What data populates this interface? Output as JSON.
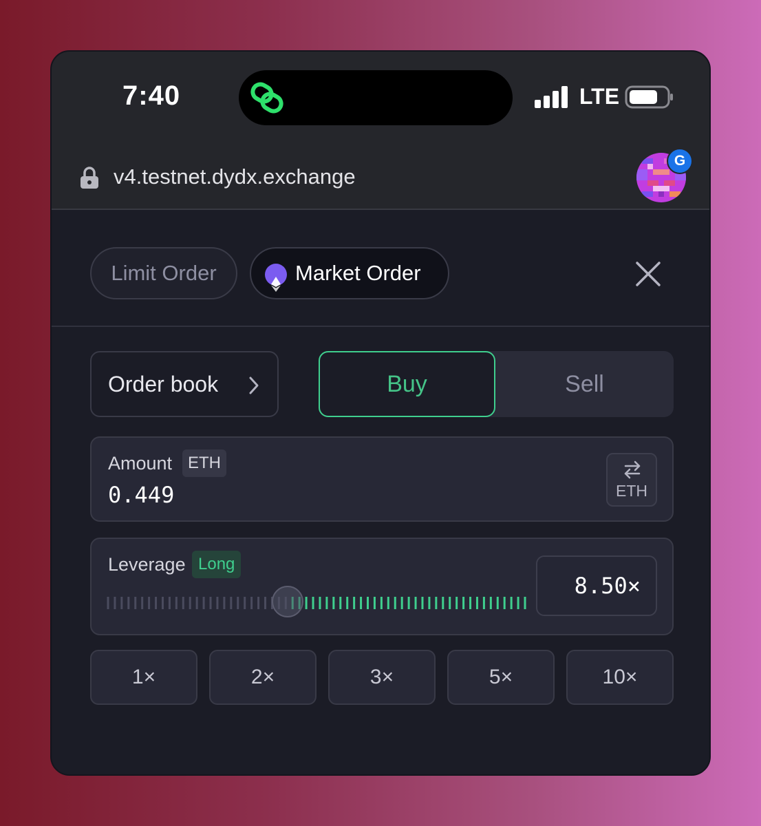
{
  "status_bar": {
    "time": "7:40",
    "network": "LTE"
  },
  "browser": {
    "url": "v4.testnet.dydx.exchange",
    "profile_badge": "G"
  },
  "order_tabs": {
    "limit_label": "Limit Order",
    "market_label": "Market Order",
    "active": "Market Order"
  },
  "trade": {
    "order_book_label": "Order book",
    "buy_label": "Buy",
    "sell_label": "Sell",
    "selected_side": "Buy"
  },
  "amount": {
    "label": "Amount",
    "asset": "ETH",
    "value": "0.449",
    "swap_label": "ETH"
  },
  "leverage": {
    "label": "Leverage",
    "direction": "Long",
    "value": "8.50×",
    "slider_fraction": 0.43
  },
  "presets": [
    "1×",
    "2×",
    "3×",
    "5×",
    "10×"
  ],
  "colors": {
    "accent_green": "#3fcf8e",
    "panel_bg": "#1b1c26",
    "eth_purple": "#7b5cf0"
  },
  "icons": [
    "dynamic-island-link-icon",
    "signal-icon",
    "battery-icon",
    "lock-icon",
    "ethereum-icon",
    "close-icon",
    "chevron-right-icon",
    "swap-icon"
  ]
}
